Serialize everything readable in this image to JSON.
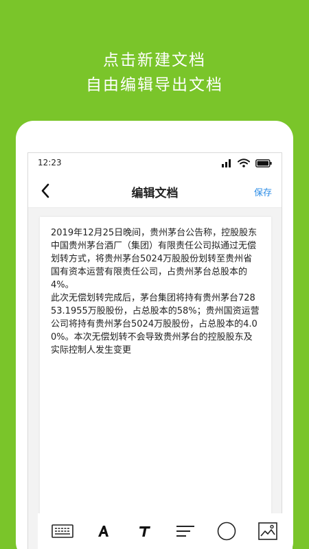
{
  "promo": {
    "line1": "点击新建文档",
    "line2": "自由编辑导出文档"
  },
  "status_bar": {
    "time": "12:23",
    "icons": [
      "signal-icon",
      "wifi-icon",
      "battery-icon"
    ]
  },
  "nav": {
    "back_icon": "chevron-left-icon",
    "title": "编辑文档",
    "save_label": "保存"
  },
  "document": {
    "body": "2019年12月25日晚间，贵州茅台公告称，控股股东中国贵州茅台酒厂（集团）有限责任公司拟通过无偿划转方式，将贵州茅台5024万股股份划转至贵州省国有资本运营有限责任公司，占贵州茅台总股本的4%。\n此次无偿划转完成后，茅台集团将持有贵州茅台72853.1955万股股份，占总股本的58%；贵州国资运营公司将持有贵州茅台5024万股股份，占总股本的4.00%。本次无偿划转不会导致贵州茅台的控股股东及实际控制人发生变更"
  },
  "toolbar": {
    "items": [
      "keyboard-icon",
      "font-style-icon",
      "text-size-icon",
      "align-icon",
      "shape-icon",
      "image-icon"
    ]
  },
  "colors": {
    "background": "#7ac52a",
    "accent": "#2b8ce6"
  }
}
